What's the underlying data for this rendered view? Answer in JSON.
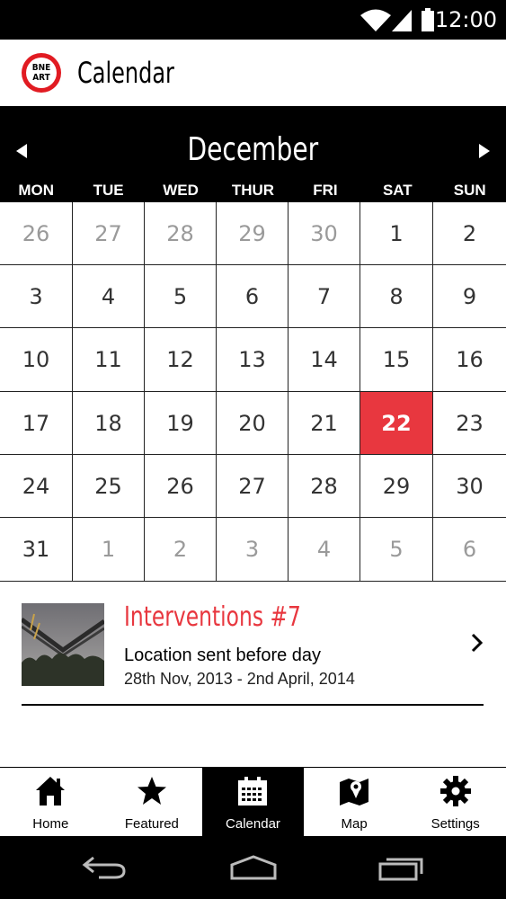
{
  "status": {
    "time": "12:00"
  },
  "app_bar": {
    "logo_text_top": "BNE",
    "logo_text_bottom": "ART",
    "title": "Calendar"
  },
  "calendar": {
    "month": "December",
    "weekdays": [
      "MON",
      "TUE",
      "WED",
      "THUR",
      "FRI",
      "SAT",
      "SUN"
    ],
    "weeks": [
      [
        {
          "d": "26",
          "m": true
        },
        {
          "d": "27",
          "m": true
        },
        {
          "d": "28",
          "m": true
        },
        {
          "d": "29",
          "m": true
        },
        {
          "d": "30",
          "m": true
        },
        {
          "d": "1"
        },
        {
          "d": "2"
        }
      ],
      [
        {
          "d": "3"
        },
        {
          "d": "4"
        },
        {
          "d": "5"
        },
        {
          "d": "6"
        },
        {
          "d": "7"
        },
        {
          "d": "8"
        },
        {
          "d": "9"
        }
      ],
      [
        {
          "d": "10"
        },
        {
          "d": "11"
        },
        {
          "d": "12"
        },
        {
          "d": "13"
        },
        {
          "d": "14"
        },
        {
          "d": "15"
        },
        {
          "d": "16"
        }
      ],
      [
        {
          "d": "17"
        },
        {
          "d": "18"
        },
        {
          "d": "19"
        },
        {
          "d": "20"
        },
        {
          "d": "21"
        },
        {
          "d": "22",
          "s": true
        },
        {
          "d": "23"
        }
      ],
      [
        {
          "d": "24"
        },
        {
          "d": "25"
        },
        {
          "d": "26"
        },
        {
          "d": "27"
        },
        {
          "d": "28"
        },
        {
          "d": "29"
        },
        {
          "d": "30"
        }
      ],
      [
        {
          "d": "31"
        },
        {
          "d": "1",
          "m": true
        },
        {
          "d": "2",
          "m": true
        },
        {
          "d": "3",
          "m": true
        },
        {
          "d": "4",
          "m": true
        },
        {
          "d": "5",
          "m": true
        },
        {
          "d": "6",
          "m": true
        }
      ]
    ],
    "selected_color": "#e8373f"
  },
  "event": {
    "title": "Interventions #7",
    "subtitle": "Location sent before day",
    "dates": "28th Nov, 2013 - 2nd April, 2014",
    "icon": "chevron-right-icon"
  },
  "tabs": [
    {
      "label": "Home",
      "icon": "home-icon",
      "active": false
    },
    {
      "label": "Featured",
      "icon": "star-icon",
      "active": false
    },
    {
      "label": "Calendar",
      "icon": "calendar-icon",
      "active": true
    },
    {
      "label": "Map",
      "icon": "map-icon",
      "active": false
    },
    {
      "label": "Settings",
      "icon": "gear-icon",
      "active": false
    }
  ],
  "colors": {
    "accent": "#e8373f",
    "brand_red": "#e11b22",
    "bar": "#000000"
  }
}
